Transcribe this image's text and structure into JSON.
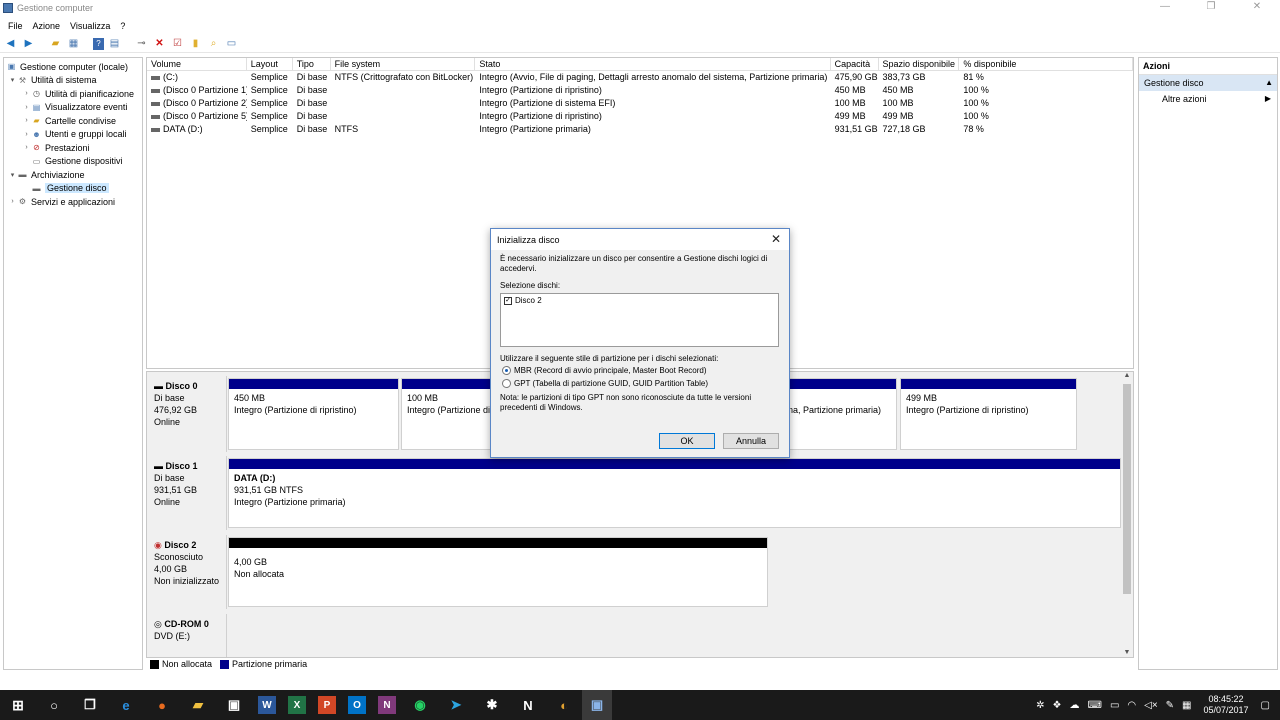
{
  "window": {
    "title": "Gestione computer"
  },
  "menu": [
    "File",
    "Azione",
    "Visualizza",
    "?"
  ],
  "tree": [
    {
      "label": "Gestione computer (locale)",
      "level": 0,
      "arrow": "",
      "icon": "computer-icon"
    },
    {
      "label": "Utilità di sistema",
      "level": 1,
      "arrow": "▾",
      "icon": "tools-icon"
    },
    {
      "label": "Utilità di pianificazione",
      "level": 2,
      "arrow": "›",
      "icon": "clock-icon"
    },
    {
      "label": "Visualizzatore eventi",
      "level": 2,
      "arrow": "›",
      "icon": "event-viewer-icon"
    },
    {
      "label": "Cartelle condivise",
      "level": 2,
      "arrow": "›",
      "icon": "shared-folder-icon"
    },
    {
      "label": "Utenti e gruppi locali",
      "level": 2,
      "arrow": "›",
      "icon": "users-icon"
    },
    {
      "label": "Prestazioni",
      "level": 2,
      "arrow": "›",
      "icon": "performance-icon"
    },
    {
      "label": "Gestione dispositivi",
      "level": 2,
      "arrow": "",
      "icon": "device-manager-icon"
    },
    {
      "label": "Archiviazione",
      "level": 1,
      "arrow": "▾",
      "icon": "storage-icon"
    },
    {
      "label": "Gestione disco",
      "level": 2,
      "arrow": "",
      "icon": "disk-management-icon",
      "selected": true
    },
    {
      "label": "Servizi e applicazioni",
      "level": 1,
      "arrow": "›",
      "icon": "services-icon"
    }
  ],
  "columns": [
    "Volume",
    "Layout",
    "Tipo",
    "File system",
    "Stato",
    "Capacità",
    "Spazio disponibile",
    "% disponibile"
  ],
  "volumes": [
    [
      "(C:)",
      "Semplice",
      "Di base",
      "NTFS (Crittografato con BitLocker)",
      "Integro (Avvio, File di paging, Dettagli arresto anomalo del sistema, Partizione primaria)",
      "475,90 GB",
      "383,73 GB",
      "81 %"
    ],
    [
      "(Disco 0 Partizione 1)",
      "Semplice",
      "Di base",
      "",
      "Integro (Partizione di ripristino)",
      "450 MB",
      "450 MB",
      "100 %"
    ],
    [
      "(Disco 0 Partizione 2)",
      "Semplice",
      "Di base",
      "",
      "Integro (Partizione di sistema EFI)",
      "100 MB",
      "100 MB",
      "100 %"
    ],
    [
      "(Disco 0 Partizione 5)",
      "Semplice",
      "Di base",
      "",
      "Integro (Partizione di ripristino)",
      "499 MB",
      "499 MB",
      "100 %"
    ],
    [
      "DATA (D:)",
      "Semplice",
      "Di base",
      "NTFS",
      "Integro (Partizione primaria)",
      "931,51 GB",
      "727,18 GB",
      "78 %"
    ]
  ],
  "disks": {
    "d0": {
      "name": "Disco 0",
      "type": "Di base",
      "size": "476,92 GB",
      "status": "Online"
    },
    "d1": {
      "name": "Disco 1",
      "type": "Di base",
      "size": "931,51 GB",
      "status": "Online"
    },
    "d2": {
      "name": "Disco 2",
      "type": "Sconosciuto",
      "size": "4,00 GB",
      "status": "Non inizializzato"
    },
    "d3": {
      "name": "CD-ROM 0",
      "type": "DVD (E:)"
    }
  },
  "partitions": {
    "d0p1": {
      "size": "450 MB",
      "status": "Integro (Partizione di ripristino)"
    },
    "d0p2": {
      "size": "100 MB",
      "status": "Integro (Partizione di"
    },
    "d0p3": {
      "status": "na, Partizione primaria)"
    },
    "d0p4": {
      "size": "499 MB",
      "status": "Integro (Partizione di ripristino)"
    },
    "d1p1": {
      "name": "DATA  (D:)",
      "size": "931,51 GB NTFS",
      "status": "Integro (Partizione primaria)"
    },
    "d2p1": {
      "size": "4,00 GB",
      "status": "Non allocata"
    }
  },
  "legend": [
    {
      "label": "Non allocata",
      "color": "#000000"
    },
    {
      "label": "Partizione primaria",
      "color": "#00008b"
    }
  ],
  "actions": {
    "header": "Azioni",
    "section": "Gestione disco",
    "item": "Altre azioni"
  },
  "dialog": {
    "title": "Inizializza disco",
    "intro": "È necessario inizializzare un disco per consentire a Gestione dischi logici di accedervi.",
    "select_label": "Selezione dischi:",
    "disk_item": "Disco 2",
    "style_label": "Utilizzare il seguente stile di partizione per i dischi selezionati:",
    "mbr": "MBR (Record di avvio principale, Master Boot Record)",
    "gpt": "GPT (Tabella di partizione GUID, GUID Partition Table)",
    "note": "Nota: le partizioni di tipo GPT non sono riconosciute da tutte le versioni precedenti di Windows.",
    "ok": "OK",
    "cancel": "Annulla"
  },
  "clock": {
    "time": "08:45:22",
    "date": "05/07/2017"
  }
}
